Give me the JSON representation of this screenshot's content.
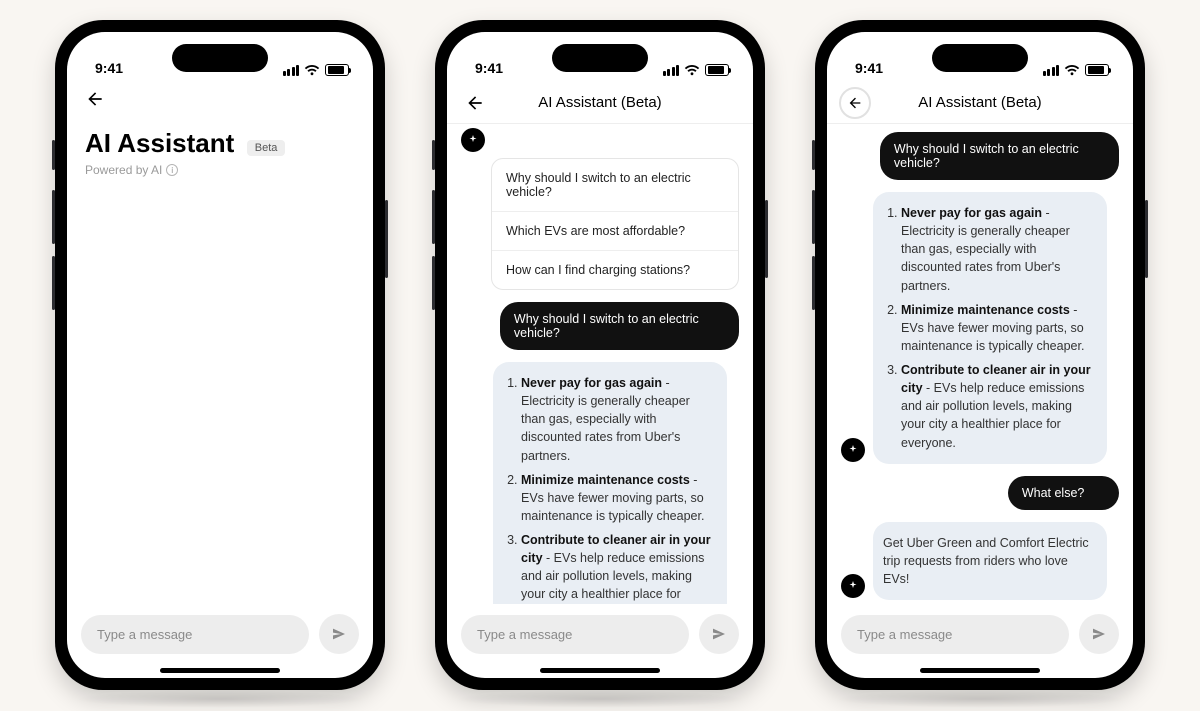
{
  "colors": {
    "user_bubble": "#111111",
    "ai_bubble": "#e9eef4",
    "input_bg": "#ededed"
  },
  "status": {
    "time": "9:41"
  },
  "screen1": {
    "title": "AI Assistant",
    "badge": "Beta",
    "powered": "Powered by AI",
    "input_placeholder": "Type a message"
  },
  "screen2": {
    "header_title": "AI Assistant (Beta)",
    "suggestions": [
      "Why should I switch to an electric vehicle?",
      "Which EVs are most affordable?",
      "How can I find charging stations?"
    ],
    "user_msg": "Why should I switch to an electric vehicle?",
    "points": [
      {
        "title": "Never pay for gas again",
        "body": " - Electricity is generally cheaper than gas, especially with discounted rates from Uber's partners."
      },
      {
        "title": "Minimize maintenance costs",
        "body": " - EVs have fewer moving parts, so maintenance is typically cheaper."
      },
      {
        "title": "Contribute to cleaner air in your city",
        "body": " - EVs help reduce emissions and air pollution levels, making your city a healthier place for everyone."
      }
    ],
    "input_placeholder": "Type a message"
  },
  "screen3": {
    "header_title": "AI Assistant (Beta)",
    "user_msg1": "Why should I switch to an electric vehicle?",
    "points": [
      {
        "title": "Never pay for gas again",
        "body": " - Electricity is generally cheaper than gas, especially with discounted rates from Uber's partners."
      },
      {
        "title": "Minimize maintenance costs",
        "body": " - EVs have fewer moving parts, so maintenance is typically cheaper."
      },
      {
        "title": "Contribute to cleaner air in your city",
        "body": " - EVs help reduce emissions and air pollution levels, making your city a healthier place for everyone."
      }
    ],
    "user_msg2": "What else?",
    "ai_msg2": "Get Uber Green and Comfort Electric trip requests from riders who love EVs!",
    "input_placeholder": "Type a message"
  }
}
